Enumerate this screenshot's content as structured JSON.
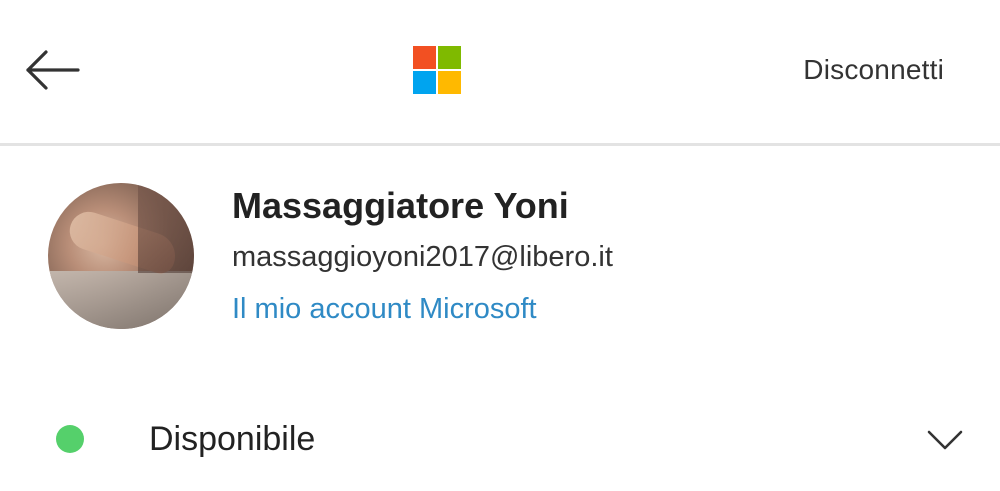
{
  "header": {
    "back_icon": "arrow-left-icon",
    "logo": {
      "icon": "microsoft-logo-icon",
      "colors": [
        "#f25022",
        "#7fba00",
        "#00a4ef",
        "#ffb900"
      ]
    },
    "signout_label": "Disconnetti"
  },
  "profile": {
    "avatar": "avatar-photo",
    "name": "Massaggiatore Yoni",
    "email": "massaggioyoni2017@libero.it",
    "account_link": "Il mio account Microsoft"
  },
  "status": {
    "label": "Disponibile",
    "color": "#55d06b",
    "expand_icon": "chevron-down-icon"
  },
  "colors": {
    "link": "#2f8ac5",
    "text": "#222222",
    "divider": "#e3e3e3"
  }
}
